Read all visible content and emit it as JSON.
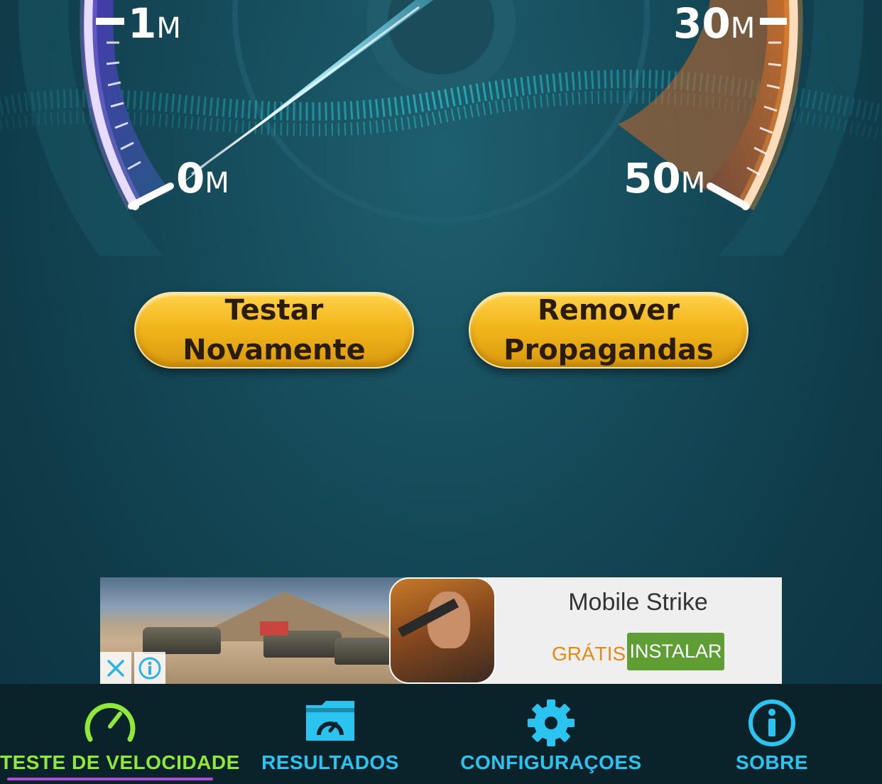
{
  "gauge": {
    "labels": [
      {
        "num": "1",
        "unit": "M"
      },
      {
        "num": "0",
        "unit": "M"
      },
      {
        "num": "30",
        "unit": "M"
      },
      {
        "num": "50",
        "unit": "M"
      }
    ]
  },
  "buttons": {
    "retest": {
      "line1": "Testar",
      "line2": "Novamente"
    },
    "remove_ads": {
      "line1": "Remover",
      "line2": "Propagandas"
    }
  },
  "ad": {
    "title": "Mobile Strike",
    "price": "GRÁTIS",
    "install_label": "INSTALAR",
    "close_icon": "close-icon",
    "info_icon": "info-icon"
  },
  "tabs": [
    {
      "label": "TESTE DE VELOCIDADE",
      "icon": "speedometer-icon",
      "color": "#8fe83a",
      "active": true
    },
    {
      "label": "RESULTADOS",
      "icon": "results-folder-icon",
      "color": "#2bc3f0"
    },
    {
      "label": "CONFIGURAÇOES",
      "icon": "gear-icon",
      "color": "#2bc3f0"
    },
    {
      "label": "SOBRE",
      "icon": "info-icon",
      "color": "#2bc3f0"
    }
  ],
  "colors": {
    "accent_cyan": "#2bc3f0",
    "active_green": "#8fe83a",
    "button_gold": "#f2b61c",
    "gauge_orange": "#ff8a1e",
    "gauge_purple": "#6b4cf0"
  }
}
